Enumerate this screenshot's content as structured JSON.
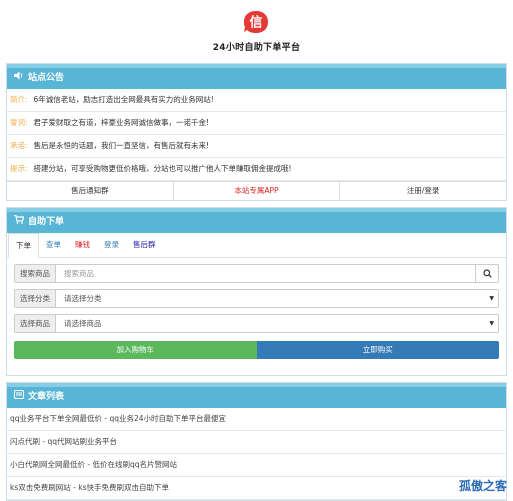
{
  "header": {
    "logo_glyph": "信",
    "title": "24小时自助下单平台"
  },
  "notice": {
    "heading": "站点公告",
    "rows": [
      {
        "tag": "简介:",
        "tag_color": "#f0ad4e",
        "text": "6年诚信老站，励志打造出全网最具有实力的业务网站!"
      },
      {
        "tag": "誓词:",
        "tag_color": "#f0ad4e",
        "text": "君子爱财取之有道，梓豪业务网诚信做事，一诺千金!"
      },
      {
        "tag": "承诺:",
        "tag_color": "#f0ad4e",
        "text": "售后是永恒的话题，我们一直坚信，有售后就有未来!"
      },
      {
        "tag": "提示:",
        "tag_color": "#f0ad4e",
        "text": "搭建分站，可享受购物更低价格哦，分站也可以推广他人下单赚取佣金提成哦!"
      }
    ],
    "links": [
      {
        "label": "售后通知群",
        "color": "#333333"
      },
      {
        "label": "本站专属APP",
        "color": "#e02020"
      },
      {
        "label": "注册/登录",
        "color": "#333333"
      }
    ]
  },
  "order": {
    "heading": "自助下单",
    "tabs": [
      {
        "label": "下单",
        "color": "#333333"
      },
      {
        "label": "查单",
        "color": "#337ab7"
      },
      {
        "label": "赚钱",
        "color": "#e02020"
      },
      {
        "label": "登录",
        "color": "#337ab7"
      },
      {
        "label": "售后群",
        "color": "#1a1aa6"
      }
    ],
    "search_label": "搜索商品",
    "search_placeholder": "搜索商品",
    "category_label": "选择分类",
    "category_value": "请选择分类",
    "product_label": "选择商品",
    "product_value": "请选择商品",
    "add_cart": "加入购物车",
    "buy_now": "立即购买"
  },
  "articles": {
    "heading": "文章列表",
    "items": [
      "qq业务平台下单全网最低价 - qq业务24小时自助下单平台最便宜",
      "闪点代刷 - qq代网站刷业务平台",
      "小白代刷网全网最低价 - 低价在线刷qq名片赞网站",
      "ks双击免费刷网站 - ks快手免费刷双击自助下单"
    ]
  },
  "watermark": "孤傲之客",
  "colors": {
    "accent": "#59b5d5",
    "green": "#5cb85c",
    "blue": "#337ab7",
    "logo": "#e53935"
  }
}
